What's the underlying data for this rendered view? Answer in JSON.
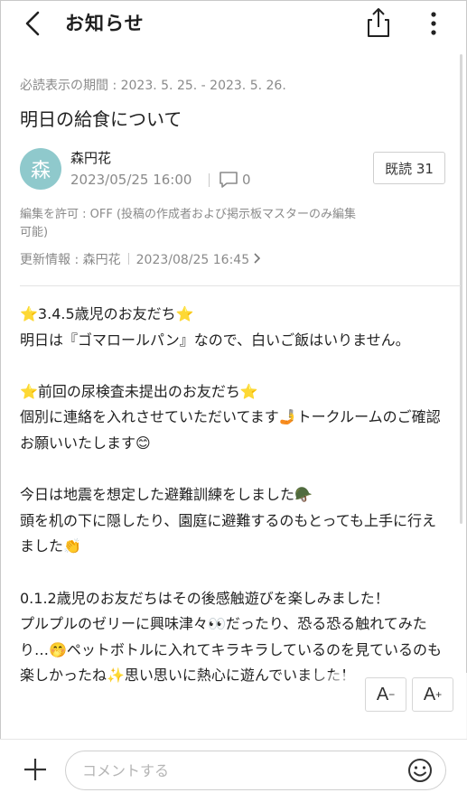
{
  "header": {
    "title": "お知らせ"
  },
  "post": {
    "period": "必読表示の期間 : 2023. 5. 25. - 2023. 5. 26.",
    "title": "明日の給食について",
    "avatar_char": "森",
    "author": "森円花",
    "date": "2023/05/25 16:00",
    "comment_count": "0",
    "read_label": "既読 31",
    "permission": "編集を許可 : OFF (投稿の作成者および掲示板マスターのみ編集可能)",
    "update_label": "更新情報 : 森円花",
    "update_date": "2023/08/25 16:45",
    "body": [
      "⭐3.4.5歳児のお友だち⭐",
      "明日は『ゴマロールパン』なので、白いご飯はいりません。",
      "",
      "⭐前回の尿検査未提出のお友だち⭐",
      "個別に連絡を入れさせていただいてます🤳トークルームのご確認お願いいたします😊",
      "",
      "今日は地震を想定した避難訓練をしました🪖",
      "頭を机の下に隠したり、園庭に避難するのもとっても上手に行えました👏",
      "",
      "0.1.2歳児のお友だちはその後感触遊びを楽しみました！",
      "プルプルのゼリーに興味津々👀だったり、恐る恐る触れてみたり…🤭ペットボトルに入れてキラキラしているのを見ているのも楽しかったね✨思い思いに熱心に遊んでいました！"
    ]
  },
  "font_controls": {
    "decrease": "A",
    "increase": "A"
  },
  "composer": {
    "placeholder": "コメントする"
  },
  "icons": [
    "back-icon",
    "share-icon",
    "more-icon",
    "comment-icon",
    "chevron-right-icon",
    "plus-icon",
    "emoji-icon"
  ]
}
